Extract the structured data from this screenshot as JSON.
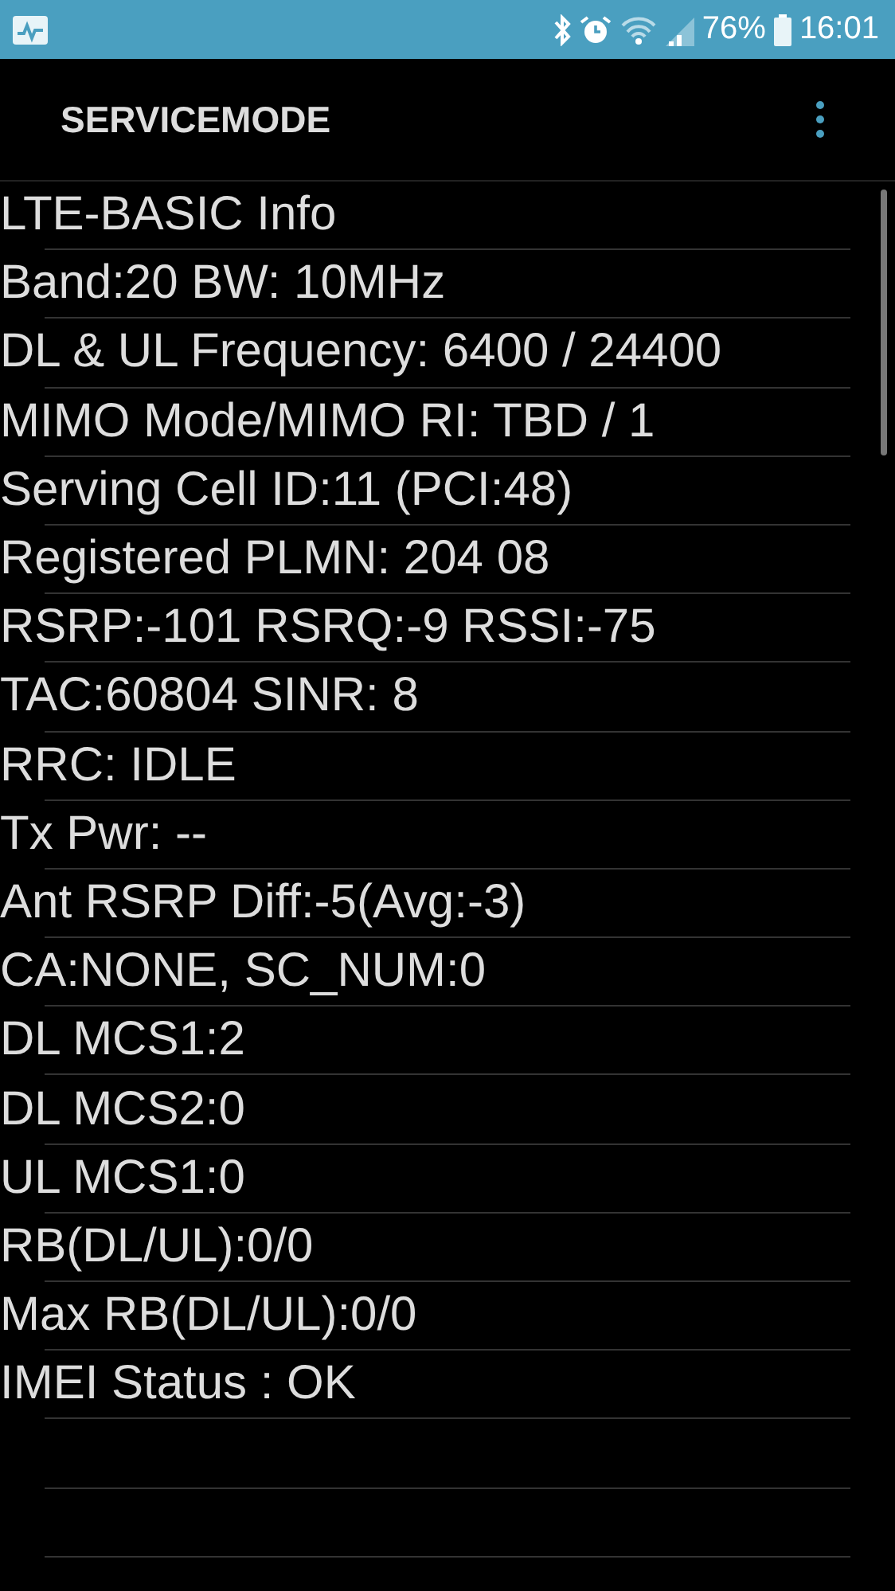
{
  "status_bar": {
    "battery": "76%",
    "time": "16:01"
  },
  "toolbar": {
    "title": "SERVICEMODE"
  },
  "lines": [
    "LTE-BASIC Info",
    "Band:20 BW: 10MHz",
    "DL & UL Frequency: 6400 / 24400",
    "MIMO Mode/MIMO RI: TBD / 1",
    "Serving Cell ID:11 (PCI:48)",
    "Registered PLMN: 204 08",
    "RSRP:-101 RSRQ:-9 RSSI:-75",
    "TAC:60804 SINR: 8",
    "RRC: IDLE",
    "Tx Pwr: --",
    "Ant RSRP Diff:-5(Avg:-3)",
    "CA:NONE, SC_NUM:0",
    "DL MCS1:2",
    "DL MCS2:0",
    "UL MCS1:0",
    "RB(DL/UL):0/0",
    "Max RB(DL/UL):0/0",
    "IMEI Status : OK"
  ]
}
